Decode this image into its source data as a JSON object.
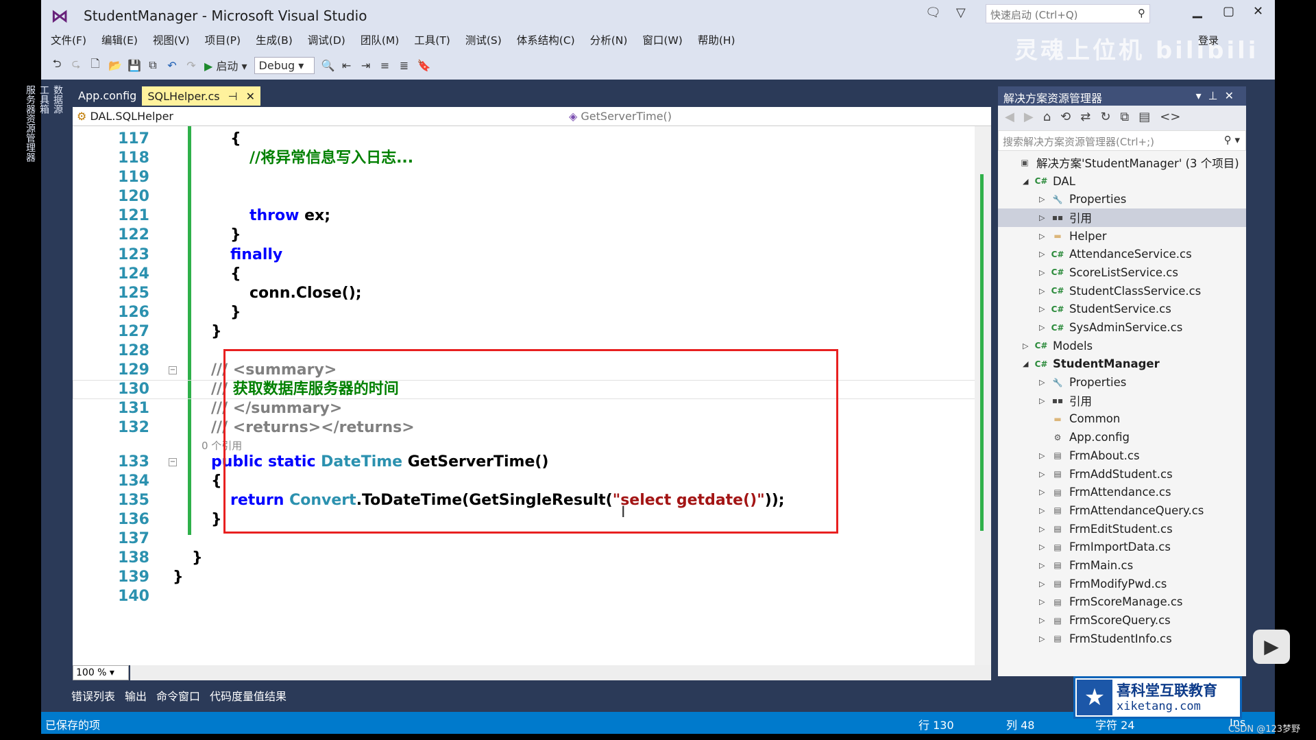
{
  "window": {
    "title": "StudentManager - Microsoft Visual Studio",
    "quick_launch_placeholder": "快速启动 (Ctrl+Q)",
    "login": "登录",
    "watermark": "灵魂上位机 bilibili"
  },
  "menu": [
    "文件(F)",
    "编辑(E)",
    "视图(V)",
    "项目(P)",
    "生成(B)",
    "调试(D)",
    "团队(M)",
    "工具(T)",
    "测试(S)",
    "体系结构(C)",
    "分析(N)",
    "窗口(W)",
    "帮助(H)"
  ],
  "toolbar": {
    "start_label": "启动",
    "config": "Debug"
  },
  "left_strip": [
    "数据源",
    "工具箱",
    "服务器资源管理器"
  ],
  "tabs": [
    {
      "label": "App.config",
      "active": false
    },
    {
      "label": "SQLHelper.cs",
      "active": true
    }
  ],
  "navbar": {
    "class": "DAL.SQLHelper",
    "member": "GetServerTime()"
  },
  "code": {
    "lens_text": "0 个引用",
    "lines": [
      {
        "n": "117",
        "i": 3,
        "tokens": [
          {
            "t": "{",
            "c": "p"
          }
        ]
      },
      {
        "n": "118",
        "i": 4,
        "tokens": [
          {
            "t": "//将异常信息写入日志...",
            "c": "c"
          }
        ]
      },
      {
        "n": "119",
        "i": 0,
        "tokens": []
      },
      {
        "n": "120",
        "i": 0,
        "tokens": []
      },
      {
        "n": "121",
        "i": 4,
        "tokens": [
          {
            "t": "throw",
            "c": "k"
          },
          {
            "t": " ex;",
            "c": "p"
          }
        ]
      },
      {
        "n": "122",
        "i": 3,
        "tokens": [
          {
            "t": "}",
            "c": "p"
          }
        ]
      },
      {
        "n": "123",
        "i": 3,
        "tokens": [
          {
            "t": "finally",
            "c": "k"
          }
        ]
      },
      {
        "n": "124",
        "i": 3,
        "tokens": [
          {
            "t": "{",
            "c": "p"
          }
        ]
      },
      {
        "n": "125",
        "i": 4,
        "tokens": [
          {
            "t": "conn.Close();",
            "c": "p"
          }
        ]
      },
      {
        "n": "126",
        "i": 3,
        "tokens": [
          {
            "t": "}",
            "c": "p"
          }
        ]
      },
      {
        "n": "127",
        "i": 2,
        "tokens": [
          {
            "t": "}",
            "c": "p"
          }
        ]
      },
      {
        "n": "128",
        "i": 0,
        "tokens": []
      },
      {
        "n": "129",
        "i": 2,
        "fold": true,
        "tokens": [
          {
            "t": "/// ",
            "c": "g"
          },
          {
            "t": "<summary>",
            "c": "g"
          }
        ]
      },
      {
        "n": "130",
        "i": 2,
        "current": true,
        "tokens": [
          {
            "t": "/// ",
            "c": "g"
          },
          {
            "t": "获取数据库服务器的时间",
            "c": "c"
          }
        ]
      },
      {
        "n": "131",
        "i": 2,
        "tokens": [
          {
            "t": "/// ",
            "c": "g"
          },
          {
            "t": "</summary>",
            "c": "g"
          }
        ]
      },
      {
        "n": "132",
        "i": 2,
        "lens": true,
        "tokens": [
          {
            "t": "/// ",
            "c": "g"
          },
          {
            "t": "<returns></returns>",
            "c": "g"
          }
        ]
      },
      {
        "n": "133",
        "i": 2,
        "fold": true,
        "tokens": [
          {
            "t": "public static ",
            "c": "k"
          },
          {
            "t": "DateTime",
            "c": "t"
          },
          {
            "t": " GetServerTime()",
            "c": "p"
          }
        ]
      },
      {
        "n": "134",
        "i": 2,
        "tokens": [
          {
            "t": "{",
            "c": "p"
          }
        ]
      },
      {
        "n": "135",
        "i": 3,
        "tokens": [
          {
            "t": "return ",
            "c": "k"
          },
          {
            "t": "Convert",
            "c": "t"
          },
          {
            "t": ".ToDateTime(GetSingleResult(",
            "c": "p"
          },
          {
            "t": "\"select getdate()\"",
            "c": "s"
          },
          {
            "t": "));",
            "c": "p"
          }
        ]
      },
      {
        "n": "136",
        "i": 2,
        "tokens": [
          {
            "t": "}",
            "c": "p"
          }
        ]
      },
      {
        "n": "137",
        "i": 0,
        "tokens": []
      },
      {
        "n": "138",
        "i": 1,
        "tokens": [
          {
            "t": "}",
            "c": "p"
          }
        ]
      },
      {
        "n": "139",
        "i": 0,
        "tokens": [
          {
            "t": "}",
            "c": "p"
          }
        ]
      },
      {
        "n": "140",
        "i": 0,
        "tokens": []
      }
    ]
  },
  "zoom": "100 %",
  "solution_explorer": {
    "title": "解决方案资源管理器",
    "search_placeholder": "搜索解决方案资源管理器(Ctrl+;)",
    "items": [
      {
        "label": "解决方案'StudentManager' (3 个项目)",
        "level": 0,
        "exp": "",
        "icon": "solution"
      },
      {
        "label": "DAL",
        "level": 1,
        "exp": "open",
        "icon": "csproj"
      },
      {
        "label": "Properties",
        "level": 2,
        "exp": "closed",
        "icon": "wrench"
      },
      {
        "label": "引用",
        "level": 2,
        "exp": "closed",
        "icon": "reference",
        "selected": true
      },
      {
        "label": "Helper",
        "level": 2,
        "exp": "closed",
        "icon": "folder"
      },
      {
        "label": "AttendanceService.cs",
        "level": 2,
        "exp": "closed",
        "icon": "csfile"
      },
      {
        "label": "ScoreListService.cs",
        "level": 2,
        "exp": "closed",
        "icon": "csfile"
      },
      {
        "label": "StudentClassService.cs",
        "level": 2,
        "exp": "closed",
        "icon": "csfile"
      },
      {
        "label": "StudentService.cs",
        "level": 2,
        "exp": "closed",
        "icon": "csfile"
      },
      {
        "label": "SysAdminService.cs",
        "level": 2,
        "exp": "closed",
        "icon": "csfile"
      },
      {
        "label": "Models",
        "level": 1,
        "exp": "closed",
        "icon": "csproj"
      },
      {
        "label": "StudentManager",
        "level": 1,
        "exp": "open",
        "icon": "csproj",
        "bold": true
      },
      {
        "label": "Properties",
        "level": 2,
        "exp": "closed",
        "icon": "wrench"
      },
      {
        "label": "引用",
        "level": 2,
        "exp": "closed",
        "icon": "reference"
      },
      {
        "label": "Common",
        "level": 2,
        "exp": "",
        "icon": "folder"
      },
      {
        "label": "App.config",
        "level": 2,
        "exp": "",
        "icon": "config"
      },
      {
        "label": "FrmAbout.cs",
        "level": 2,
        "exp": "closed",
        "icon": "form"
      },
      {
        "label": "FrmAddStudent.cs",
        "level": 2,
        "exp": "closed",
        "icon": "form"
      },
      {
        "label": "FrmAttendance.cs",
        "level": 2,
        "exp": "closed",
        "icon": "form"
      },
      {
        "label": "FrmAttendanceQuery.cs",
        "level": 2,
        "exp": "closed",
        "icon": "form"
      },
      {
        "label": "FrmEditStudent.cs",
        "level": 2,
        "exp": "closed",
        "icon": "form"
      },
      {
        "label": "FrmImportData.cs",
        "level": 2,
        "exp": "closed",
        "icon": "form"
      },
      {
        "label": "FrmMain.cs",
        "level": 2,
        "exp": "closed",
        "icon": "form"
      },
      {
        "label": "FrmModifyPwd.cs",
        "level": 2,
        "exp": "closed",
        "icon": "form"
      },
      {
        "label": "FrmScoreManage.cs",
        "level": 2,
        "exp": "closed",
        "icon": "form"
      },
      {
        "label": "FrmScoreQuery.cs",
        "level": 2,
        "exp": "closed",
        "icon": "form"
      },
      {
        "label": "FrmStudentInfo.cs",
        "level": 2,
        "exp": "closed",
        "icon": "form"
      }
    ]
  },
  "bottom_tabs": [
    "错误列表",
    "输出",
    "命令窗口",
    "代码度量值结果"
  ],
  "status": {
    "message": "已保存的项",
    "line": "行 130",
    "col": "列 48",
    "char": "字符 24",
    "mode": "Ins"
  },
  "brand": {
    "name": "喜科堂互联教育",
    "url": "xiketang.com"
  },
  "credit": "CSDN @123梦野"
}
